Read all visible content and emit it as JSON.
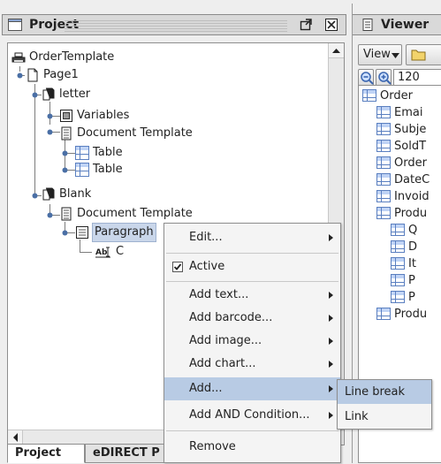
{
  "project_panel": {
    "title": "Project",
    "tree": {
      "root": "OrderTemplate",
      "page1": "Page1",
      "letter": "letter",
      "variables": "Variables",
      "doc_template_1": "Document Template",
      "table_1": "Table",
      "table_2": "Table",
      "blank": "Blank",
      "doc_template_2": "Document Template",
      "paragraph": "Paragraph",
      "text_item": "C"
    },
    "tabs": [
      "Project",
      "eDIRECT P"
    ]
  },
  "viewer_panel": {
    "title": "Viewer",
    "view_dropdown": "View",
    "zoom": "120",
    "tree": [
      {
        "label": "Order",
        "level": 0
      },
      {
        "label": "Emai",
        "level": 1
      },
      {
        "label": "Subje",
        "level": 1
      },
      {
        "label": "SoldT",
        "level": 1
      },
      {
        "label": "Order",
        "level": 1
      },
      {
        "label": "DateC",
        "level": 1
      },
      {
        "label": "Invoid",
        "level": 1
      },
      {
        "label": "Produ",
        "level": 1
      },
      {
        "label": "Q",
        "level": 2
      },
      {
        "label": "D",
        "level": 2
      },
      {
        "label": "It",
        "level": 2
      },
      {
        "label": "P",
        "level": 2
      },
      {
        "label": "P",
        "level": 2
      },
      {
        "label": "Produ",
        "level": 1
      }
    ]
  },
  "context_menu": {
    "items": [
      {
        "label": "Edit...",
        "submenu": true
      },
      {
        "label": "Active",
        "checked": true
      },
      {
        "label": "Add text...",
        "submenu": true
      },
      {
        "label": "Add barcode...",
        "submenu": true
      },
      {
        "label": "Add image...",
        "submenu": true
      },
      {
        "label": "Add chart...",
        "submenu": true
      },
      {
        "label": "Add...",
        "submenu": true,
        "highlighted": true
      },
      {
        "label": "Add AND Condition...",
        "submenu": true
      },
      {
        "label": "Remove"
      }
    ]
  },
  "submenu": {
    "items": [
      {
        "label": "Line break",
        "highlighted": true
      },
      {
        "label": "Link"
      }
    ]
  },
  "colors": {
    "selection": "#c9d6ea",
    "menu_highlight": "#b8cbe4",
    "panel_bg": "#eeeeee",
    "tree_bg": "#ffffff"
  }
}
